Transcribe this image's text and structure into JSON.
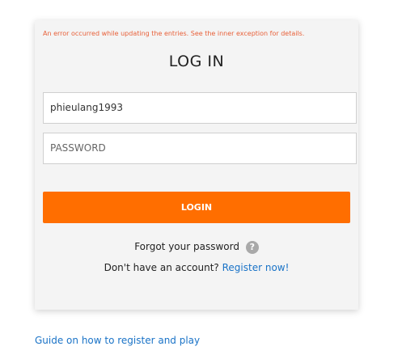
{
  "login": {
    "error_message": "An error occurred while updating the entries. See the inner exception for details.",
    "title": "LOG IN",
    "username_value": "phieulang1993",
    "password_placeholder": "PASSWORD",
    "login_label": "LOGIN",
    "forgot_label": "Forgot your password",
    "forgot_icon": "question-mark-icon",
    "no_account_text": "Don't have an account?",
    "register_label": "Register now!"
  },
  "footer": {
    "guide_label": "Guide on how to register and play"
  },
  "colors": {
    "accent": "#ff6e00",
    "error": "#e8613a",
    "link": "#1a73c7",
    "card_bg": "#f4f4f4"
  }
}
